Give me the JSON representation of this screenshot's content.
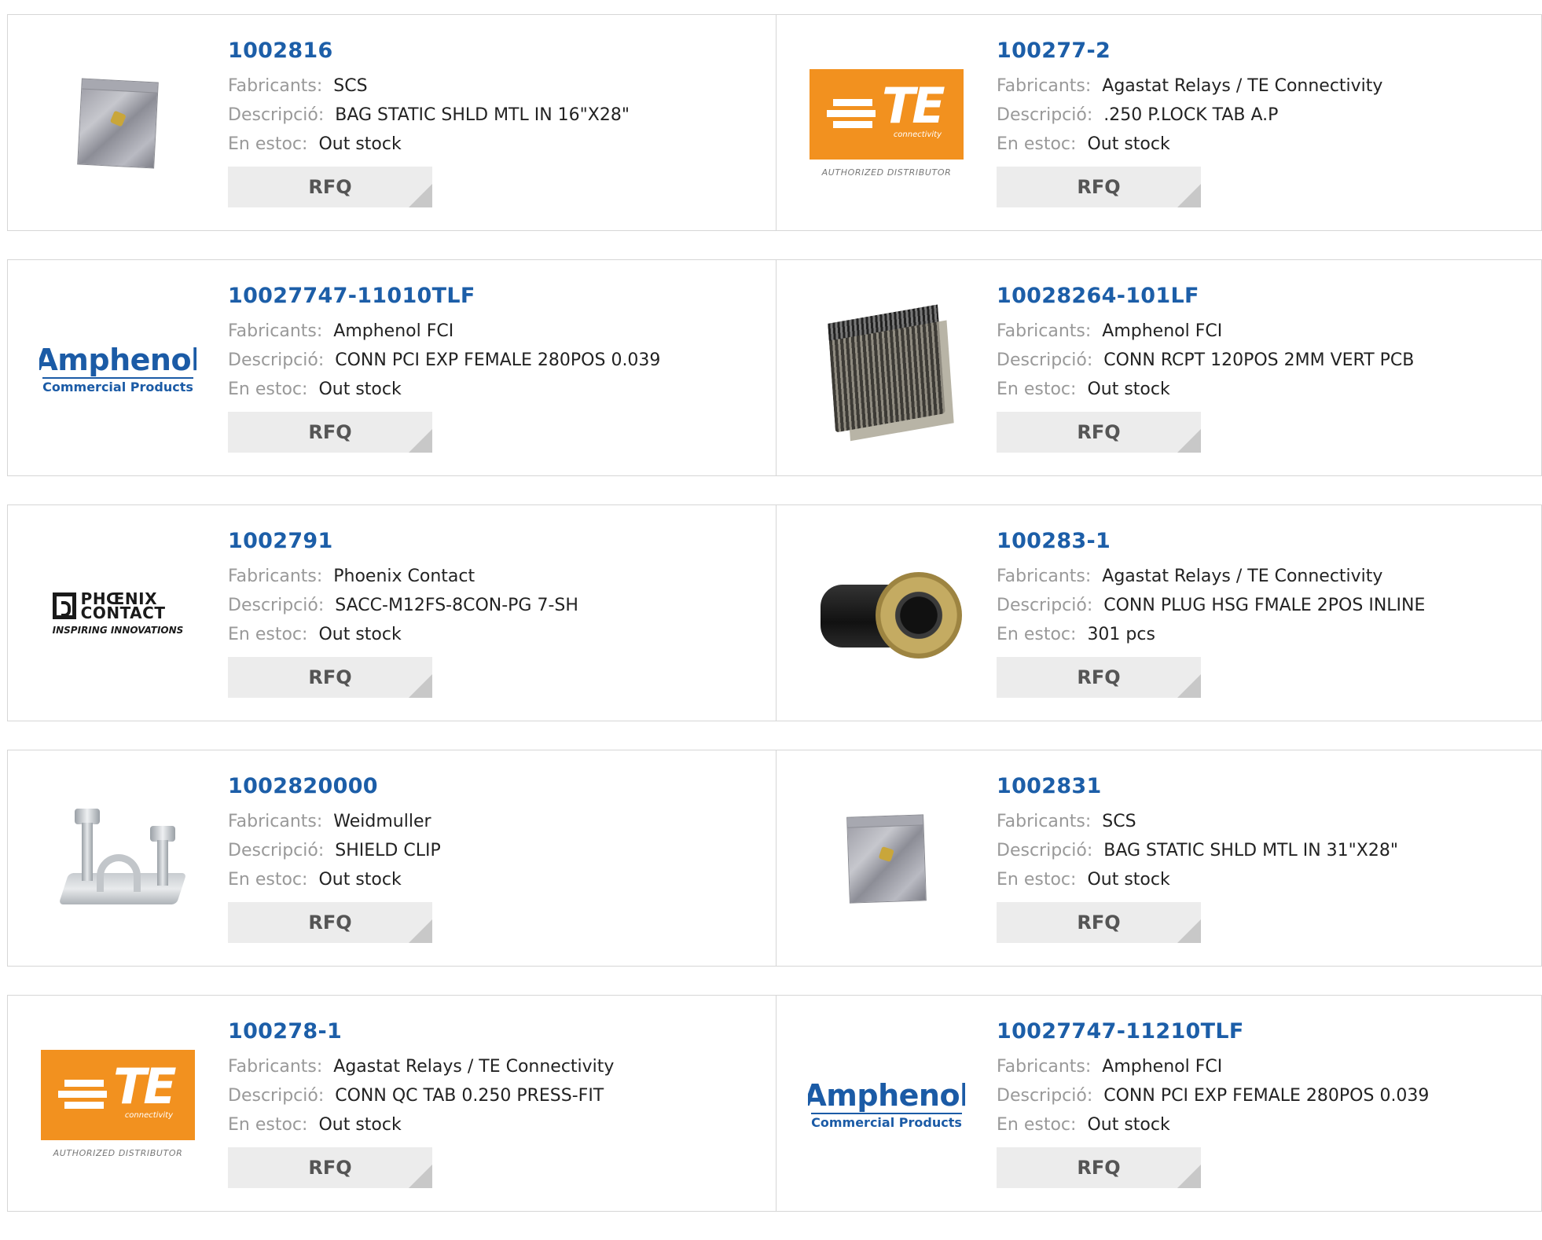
{
  "labels": {
    "manufacturer": "Fabricants:",
    "description": "Descripció:",
    "stock": "En estoc:",
    "rfq": "RFQ"
  },
  "products": [
    {
      "part": "1002816",
      "manufacturer": "SCS",
      "description": "BAG STATIC SHLD MTL IN 16\"X28\"",
      "stock": "Out stock",
      "image": "static-shielding-bag"
    },
    {
      "part": "100277-2",
      "manufacturer": "Agastat Relays / TE Connectivity",
      "description": ".250 P.LOCK TAB A.P",
      "stock": "Out stock",
      "image": "te-connectivity-logo",
      "logo_main": "TE",
      "logo_sub": "connectivity",
      "logo_caption": "AUTHORIZED DISTRIBUTOR"
    },
    {
      "part": "10027747-11010TLF",
      "manufacturer": "Amphenol FCI",
      "description": "CONN PCI EXP FEMALE 280POS 0.039",
      "stock": "Out stock",
      "image": "amphenol-logo",
      "logo_main": "Amphenol",
      "logo_sub": "Commercial Products"
    },
    {
      "part": "10028264-101LF",
      "manufacturer": "Amphenol FCI",
      "description": "CONN RCPT 120POS 2MM VERT PCB",
      "stock": "Out stock",
      "image": "pcb-connector"
    },
    {
      "part": "1002791",
      "manufacturer": "Phoenix Contact",
      "description": "SACC-M12FS-8CON-PG 7-SH",
      "stock": "Out stock",
      "image": "phoenix-contact-logo",
      "logo_line1": "PHŒNIX",
      "logo_line2": "CONTACT",
      "logo_caption": "INSPIRING INNOVATIONS"
    },
    {
      "part": "100283-1",
      "manufacturer": "Agastat Relays / TE Connectivity",
      "description": "CONN PLUG HSG FMALE 2POS INLINE",
      "stock": "301 pcs",
      "image": "circular-connector"
    },
    {
      "part": "1002820000",
      "manufacturer": "Weidmuller",
      "description": "SHIELD CLIP",
      "stock": "Out stock",
      "image": "shield-clip"
    },
    {
      "part": "1002831",
      "manufacturer": "SCS",
      "description": "BAG STATIC SHLD MTL IN 31\"X28\"",
      "stock": "Out stock",
      "image": "static-shielding-bag"
    },
    {
      "part": "100278-1",
      "manufacturer": "Agastat Relays / TE Connectivity",
      "description": "CONN QC TAB 0.250 PRESS-FIT",
      "stock": "Out stock",
      "image": "te-connectivity-logo",
      "logo_main": "TE",
      "logo_sub": "connectivity",
      "logo_caption": "AUTHORIZED DISTRIBUTOR"
    },
    {
      "part": "10027747-11210TLF",
      "manufacturer": "Amphenol FCI",
      "description": "CONN PCI EXP FEMALE 280POS 0.039",
      "stock": "Out stock",
      "image": "amphenol-logo",
      "logo_main": "Amphenol",
      "logo_sub": "Commercial Products"
    }
  ]
}
